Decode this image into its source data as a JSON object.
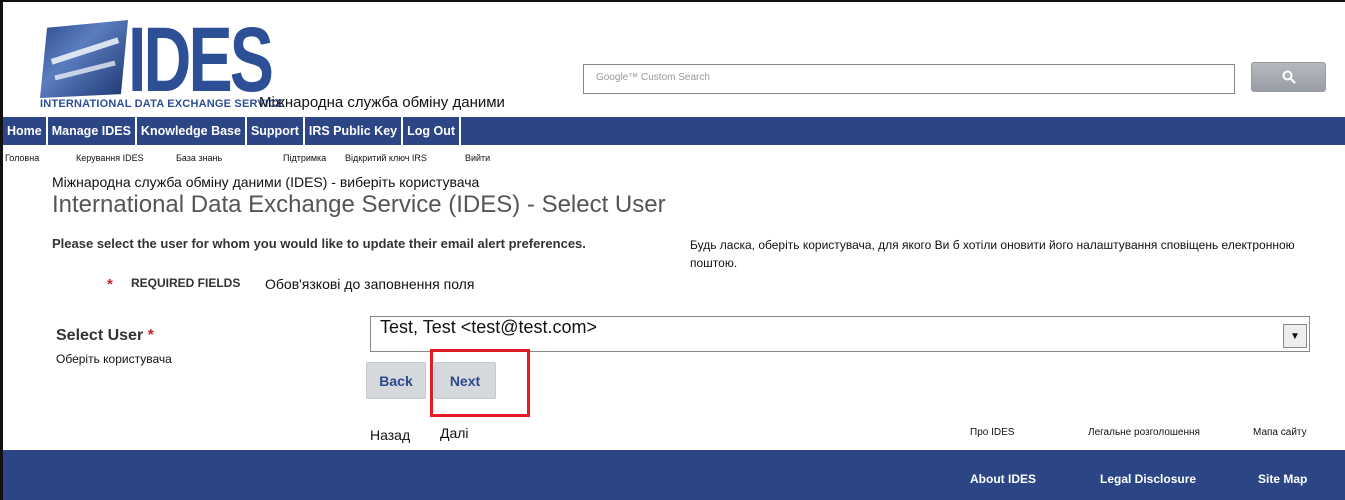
{
  "logo": {
    "brand": "IDES",
    "subtitle": "INTERNATIONAL DATA EXCHANGE SERVICE",
    "subtitle_uk": "Міжнародна служба обміну даними"
  },
  "search": {
    "placeholder": "Google™ Custom Search",
    "button_icon": "search-icon"
  },
  "nav": {
    "items": [
      {
        "label": "Home",
        "label_uk": "Головна"
      },
      {
        "label": "Manage IDES",
        "label_uk": "Керування IDES"
      },
      {
        "label": "Knowledge Base",
        "label_uk": "База знань"
      },
      {
        "label": "Support",
        "label_uk": "Підтримка"
      },
      {
        "label": "IRS Public Key",
        "label_uk": "Відкритий ключ IRS"
      },
      {
        "label": "Log Out",
        "label_uk": "Вийти"
      }
    ]
  },
  "page": {
    "title_uk": "Міжнародна служба обміну даними (IDES) - виберіть користувача",
    "title": "International Data Exchange Service (IDES) - Select User",
    "prompt": "Please select the user for whom you would like to update their email alert preferences.",
    "prompt_uk": "Будь ласка, оберіть користувача, для якого Ви б хотіли оновити його налаштування сповіщень електронною поштою.",
    "required_star": "*",
    "required_label": "REQUIRED FIELDS",
    "required_label_uk": "Обов'язкові до заповнення поля"
  },
  "form": {
    "select_label": "Select User",
    "select_star": "*",
    "select_label_uk": "Оберіть користувача",
    "select_value": "Test, Test <test@test.com>",
    "back_label": "Back",
    "next_label": "Next",
    "back_label_uk": "Назад",
    "next_label_uk": "Далі"
  },
  "footer": {
    "links": [
      {
        "label": "About IDES",
        "label_uk": "Про IDES"
      },
      {
        "label": "Legal Disclosure",
        "label_uk": "Легальне розголошення"
      },
      {
        "label": "Site Map",
        "label_uk": "Мапа сайту"
      }
    ]
  },
  "colors": {
    "nav_bg": "#2b4585",
    "brand_blue": "#2d4f96",
    "required": "#c0272d",
    "highlight": "#e01b24"
  }
}
